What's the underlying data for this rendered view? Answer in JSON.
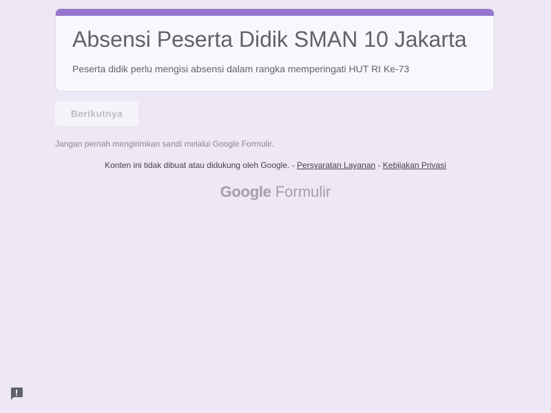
{
  "form": {
    "title": "Absensi Peserta Didik SMAN 10 Jakarta",
    "description": "Peserta didik perlu mengisi absensi dalam rangka memperingati HUT RI Ke-73",
    "accent_color": "#9575cd",
    "background_color": "#ede7f6"
  },
  "navigation": {
    "next_label": "Berikutnya"
  },
  "footer": {
    "password_warning": "Jangan pernah mengirimkan sandi melalui Google Formulir.",
    "disclaimer": "Konten ini tidak dibuat atau didukung oleh Google.",
    "separator_1": " - ",
    "terms_label": "Persyaratan Layanan",
    "separator_2": " - ",
    "privacy_label": "Kebijakan Privasi",
    "logo_google": "Google",
    "logo_product": "Formulir"
  },
  "icons": {
    "report": "report-abuse-icon"
  }
}
